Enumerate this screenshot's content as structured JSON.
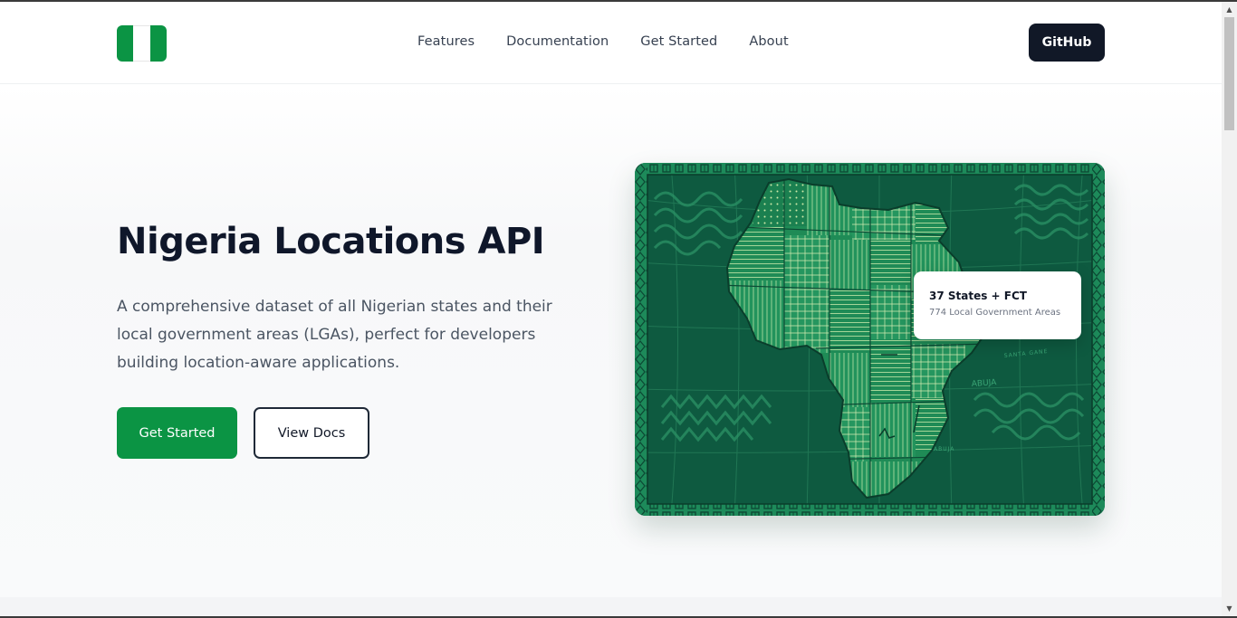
{
  "nav": {
    "logo_colors": [
      "#0b9444",
      "#ffffff",
      "#0b9444"
    ],
    "links": [
      "Features",
      "Documentation",
      "Get Started",
      "About"
    ],
    "github_label": "GitHub"
  },
  "hero": {
    "title": "Nigeria Locations API",
    "description": "A comprehensive dataset of all Nigerian states and their local government areas (LGAs), perfect for developers building location-aware applications.",
    "primary_button": "Get Started",
    "secondary_button": "View Docs"
  },
  "map_card": {
    "map_labels": [
      "ABUJA",
      "SANTA GANE",
      "ABUJA"
    ],
    "info_title": "37 States + FCT",
    "info_subtitle": "774 Local Government Areas"
  },
  "colors": {
    "brand_green": "#0b9444",
    "map_bg": "#0e5a40",
    "map_fill": "#1e8a58",
    "dark": "#111827"
  },
  "icons": [
    "nigeria-flag-logo-icon",
    "scroll-up-arrow-icon",
    "scroll-down-arrow-icon"
  ]
}
